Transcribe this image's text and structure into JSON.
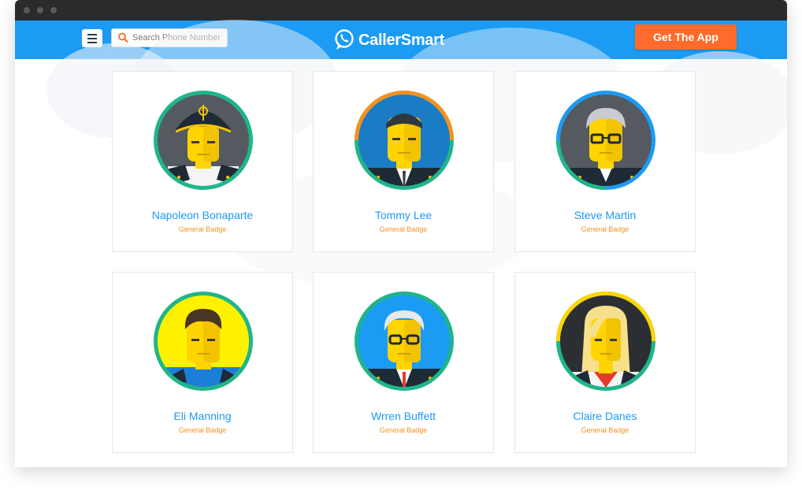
{
  "app": {
    "name": "CallerSmart"
  },
  "header": {
    "search_placeholder": "Search Phone Number",
    "cta_label": "Get The App"
  },
  "colors": {
    "brand": "#1b9bf4",
    "cta": "#ff6b2c",
    "badge": "#f7901e"
  },
  "cards": [
    {
      "name": "Napoleon Bonaparte",
      "badge": "General Badge",
      "avatar_icon": "napoleon-avatar-icon"
    },
    {
      "name": "Tommy Lee",
      "badge": "General Badge",
      "avatar_icon": "tommy-lee-avatar-icon"
    },
    {
      "name": "Steve Martin",
      "badge": "General Badge",
      "avatar_icon": "steve-martin-avatar-icon"
    },
    {
      "name": "Eli Manning",
      "badge": "General Badge",
      "avatar_icon": "eli-manning-avatar-icon"
    },
    {
      "name": "Wrren Buffett",
      "badge": "General Badge",
      "avatar_icon": "warren-buffett-avatar-icon"
    },
    {
      "name": "Claire Danes",
      "badge": "General Badge",
      "avatar_icon": "claire-danes-avatar-icon"
    }
  ]
}
